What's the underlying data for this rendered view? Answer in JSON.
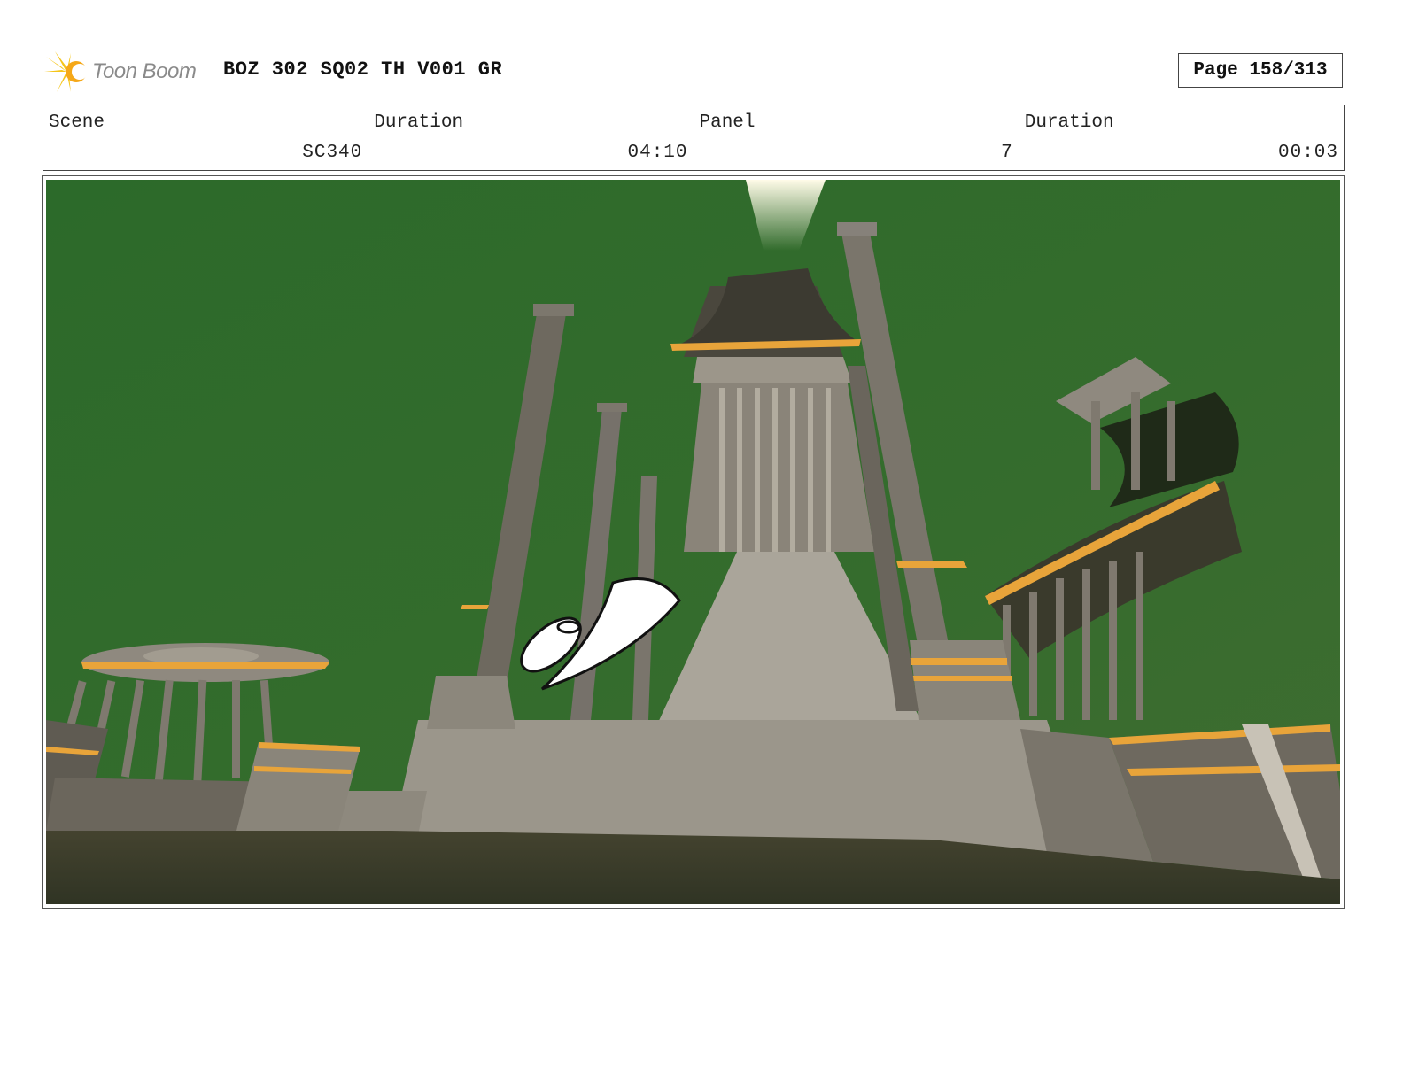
{
  "header": {
    "logo_text": "Toon Boom",
    "title": "BOZ 302 SQ02 TH V001 GR",
    "page": "Page 158/313"
  },
  "info": [
    {
      "label": "Scene",
      "value": "SC340"
    },
    {
      "label": "Duration",
      "value": "04:10"
    },
    {
      "label": "Panel",
      "value": "7"
    },
    {
      "label": "Duration",
      "value": "00:03"
    }
  ],
  "colors": {
    "sky": "#2f6b2b",
    "stone": "#8f897f",
    "gold": "#e8a43a",
    "ground": "#3b3b2d"
  }
}
